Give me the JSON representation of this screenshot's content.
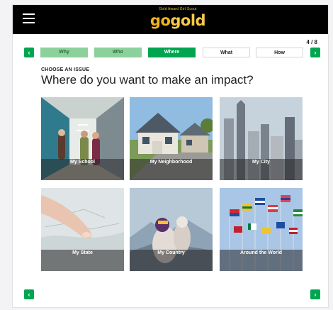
{
  "app": {
    "logo_tagline": "Gold Award Girl Scout",
    "logo_go": "go",
    "logo_gold": "gold"
  },
  "progress": {
    "label": "4 / 8"
  },
  "tabs": [
    {
      "label": "Why",
      "state": "done"
    },
    {
      "label": "Who",
      "state": "done"
    },
    {
      "label": "Where",
      "state": "active"
    },
    {
      "label": "What",
      "state": "todo"
    },
    {
      "label": "How",
      "state": "todo"
    }
  ],
  "page": {
    "kicker": "CHOOSE AN ISSUE",
    "title": "Where do you want to make an impact?"
  },
  "cards": [
    {
      "label": "My School"
    },
    {
      "label": "My Neighborhood"
    },
    {
      "label": "My City"
    },
    {
      "label": "My State"
    },
    {
      "label": "My Country"
    },
    {
      "label": "Around the World"
    }
  ],
  "nav": {
    "prev_glyph": "‹",
    "next_glyph": "›"
  },
  "colors": {
    "brand_green": "#00a550",
    "tab_done": "#8cd19c",
    "topbar": "#000000",
    "logo_gold": "#f0b41e"
  },
  "icons": {
    "menu": "hamburger-icon",
    "prev": "chevron-left-icon",
    "next": "chevron-right-icon"
  }
}
